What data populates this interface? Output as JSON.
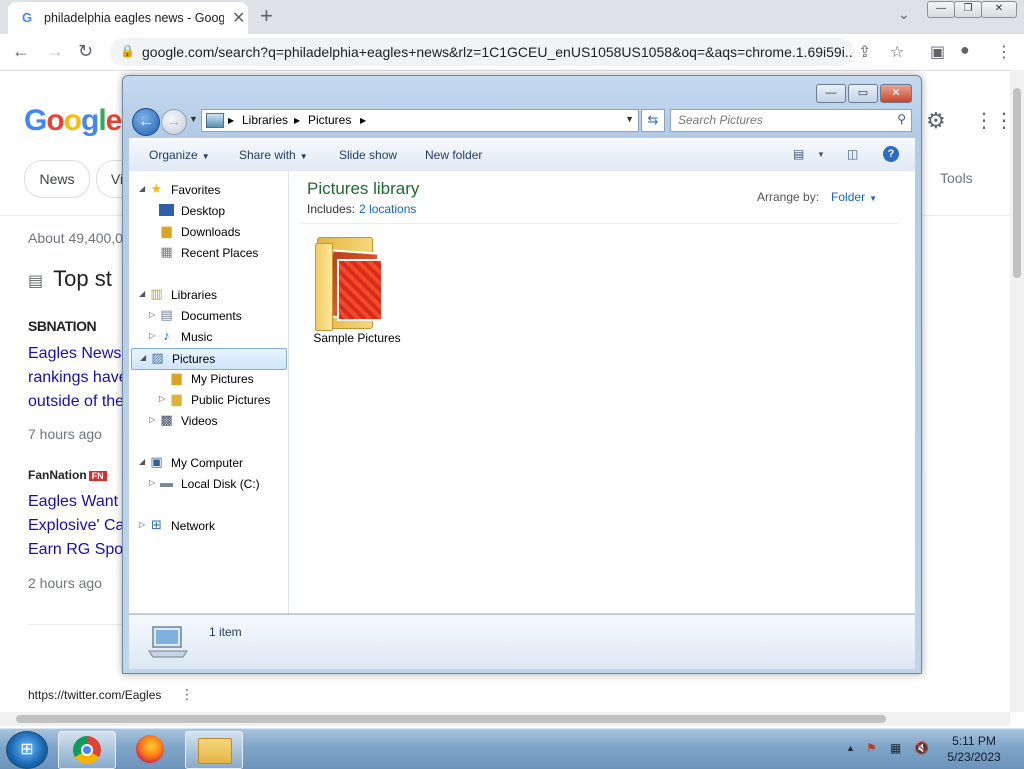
{
  "browser": {
    "tab_title": "philadelphia eagles news - Goog",
    "tab_favicon": "G",
    "url": "google.com/search?q=philadelphia+eagles+news&rlz=1C1GCEU_enUS1058US1058&oq=&aqs=chrome.1.69i59i..."
  },
  "google": {
    "logo_letters": [
      "G",
      "o",
      "o",
      "g",
      "l",
      "e"
    ],
    "logo_colors": [
      "#4285f4",
      "#ea4335",
      "#fbbc05",
      "#4285f4",
      "#34a853",
      "#ea4335"
    ],
    "chips": [
      "News",
      "Vi"
    ],
    "tools_label": "Tools",
    "about_text": "About 49,400,0",
    "top_stories": "Top st",
    "story1": {
      "source": "SBNATION",
      "lines": [
        "Eagles News",
        "rankings have",
        "outside of the"
      ],
      "time": "7 hours ago"
    },
    "story2": {
      "source": "FanNation",
      "badge": "FN",
      "lines": [
        "Eagles Want",
        "Explosive' Ca",
        "Earn RG Spo"
      ],
      "time": "2 hours ago"
    },
    "status_url": "https://twitter.com/Eagles"
  },
  "explorer": {
    "breadcrumb": [
      "Libraries",
      "Pictures"
    ],
    "search_placeholder": "Search Pictures",
    "commands": {
      "organize": "Organize",
      "share": "Share with",
      "slideshow": "Slide show",
      "newfolder": "New folder"
    },
    "nav": {
      "favorites": "Favorites",
      "desktop": "Desktop",
      "downloads": "Downloads",
      "recent": "Recent Places",
      "libraries": "Libraries",
      "documents": "Documents",
      "music": "Music",
      "pictures": "Pictures",
      "my_pictures": "My Pictures",
      "public_pictures": "Public Pictures",
      "videos": "Videos",
      "computer": "My Computer",
      "local_disk": "Local Disk (C:)",
      "network": "Network"
    },
    "library_title": "Pictures library",
    "includes_label": "Includes:",
    "includes_link": "2 locations",
    "arrange_label": "Arrange by:",
    "arrange_value": "Folder",
    "folder_name": "Sample Pictures",
    "item_count": "1 item"
  },
  "taskbar": {
    "time": "5:11 PM",
    "date": "5/23/2023"
  }
}
